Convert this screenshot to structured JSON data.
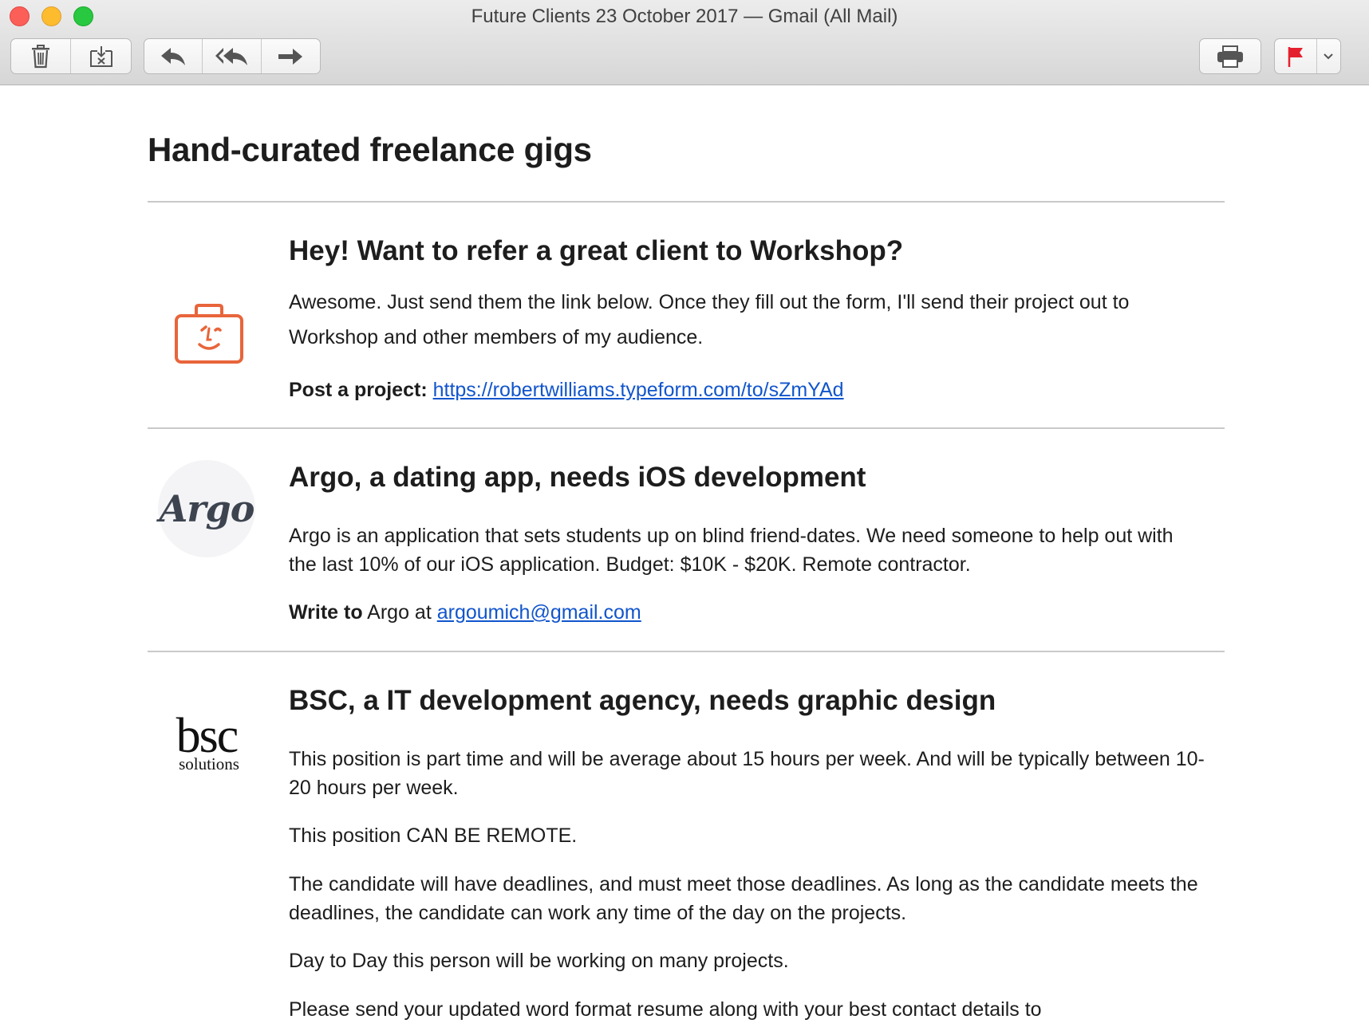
{
  "window": {
    "title": "Future Clients 23 October 2017 — Gmail (All Mail)"
  },
  "toolbar": {
    "buttons": [
      {
        "name": "delete",
        "icon": "trash-icon"
      },
      {
        "name": "junk",
        "icon": "junk-tray-icon"
      },
      {
        "name": "reply",
        "icon": "reply-icon"
      },
      {
        "name": "reply-all",
        "icon": "reply-all-icon"
      },
      {
        "name": "forward",
        "icon": "forward-icon"
      },
      {
        "name": "print",
        "icon": "printer-icon"
      },
      {
        "name": "flag",
        "icon": "flag-icon",
        "color": "#e5202e"
      },
      {
        "name": "flag-menu",
        "icon": "chevron-down-icon"
      }
    ]
  },
  "email": {
    "heading": "Hand-curated freelance gigs",
    "sections": [
      {
        "logo": "workshop-briefcase-logo",
        "logo_color": "#e8653b",
        "title": "Hey! Want to refer a great client to Workshop?",
        "body": "Awesome. Just send them the link below. Once they fill out the form, I'll send their project out to Workshop and other members of my audience.",
        "cta_label": "Post a project:",
        "cta_link": "https://robertwilliams.typeform.com/to/sZmYAd"
      },
      {
        "logo": "Argo",
        "title": "Argo, a dating app, needs iOS development",
        "body": "Argo is an application that sets students up on blind friend-dates. We need someone to help out with the last 10% of our iOS application. Budget: $10K - $20K. Remote contractor.",
        "contact_label": "Write to",
        "contact_middle": " Argo at ",
        "contact_email": "argoumich@gmail.com"
      },
      {
        "logo_main": "bsc",
        "logo_sub": "solutions",
        "title": "BSC, a IT development agency, needs graphic design",
        "paragraphs": [
          "This position is part time and will be average about 15 hours per week. And will be typically between 10-20 hours per week.",
          "This position CAN BE REMOTE.",
          "The candidate will have deadlines, and must meet those deadlines. As long as the candidate meets the deadlines, the candidate can work any time of the day on the projects.",
          "Day to Day this person will be working on many projects.",
          "Please send your updated word format resume along with your best contact details to"
        ]
      }
    ]
  },
  "colors": {
    "link": "#1155cc",
    "rule": "#c9c9c9",
    "text": "#1d1d1d"
  }
}
